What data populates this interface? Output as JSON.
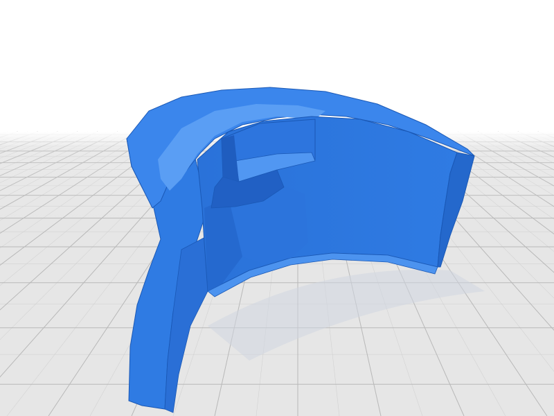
{
  "viewer": {
    "background": "#ffffff",
    "grid": {
      "floor_color": "#e6e6e6",
      "line_color": "#b8b8b8",
      "minor_line_color": "#d2d2d2",
      "visible": true
    },
    "model": {
      "icon": "3d-model-render",
      "color_main": "#2f7be3",
      "color_light": "#4a92f0",
      "color_dark": "#1e5fbf",
      "color_edge": "#1a58b5"
    }
  }
}
